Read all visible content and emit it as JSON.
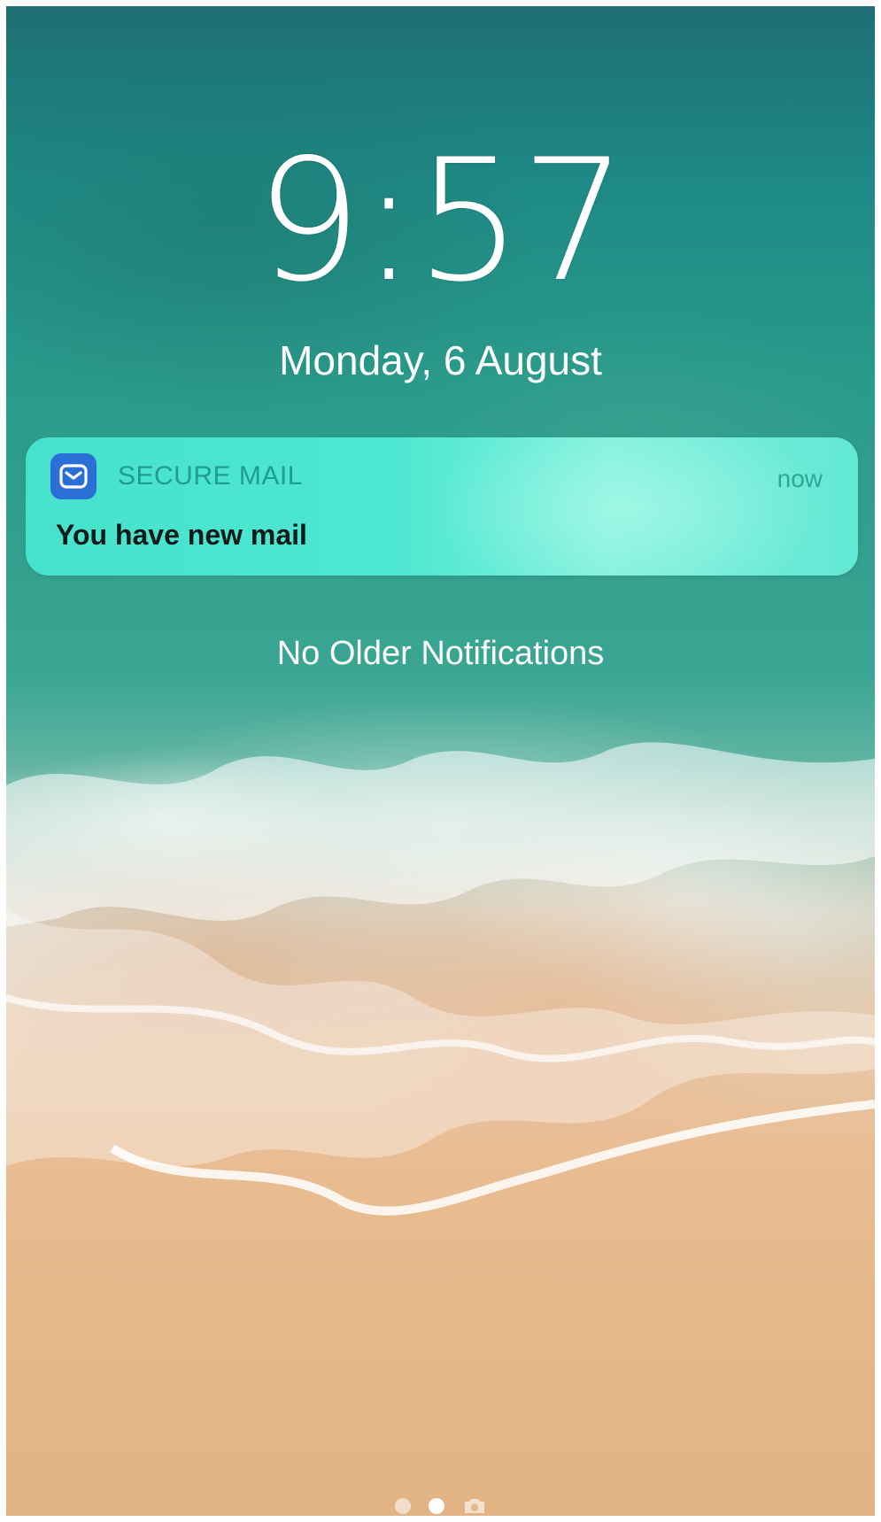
{
  "lock_screen": {
    "time": "9:57",
    "date": "Monday, 6 August"
  },
  "notification": {
    "app_name": "SECURE MAIL",
    "time": "now",
    "message": "You have new mail",
    "app_icon": "mail-check-icon",
    "accent_color": "#2a6fd6"
  },
  "status_text": {
    "no_older": "No Older Notifications"
  },
  "page_indicator": {
    "pages": 2,
    "active_page": 2,
    "trailing_icon": "camera-icon"
  }
}
